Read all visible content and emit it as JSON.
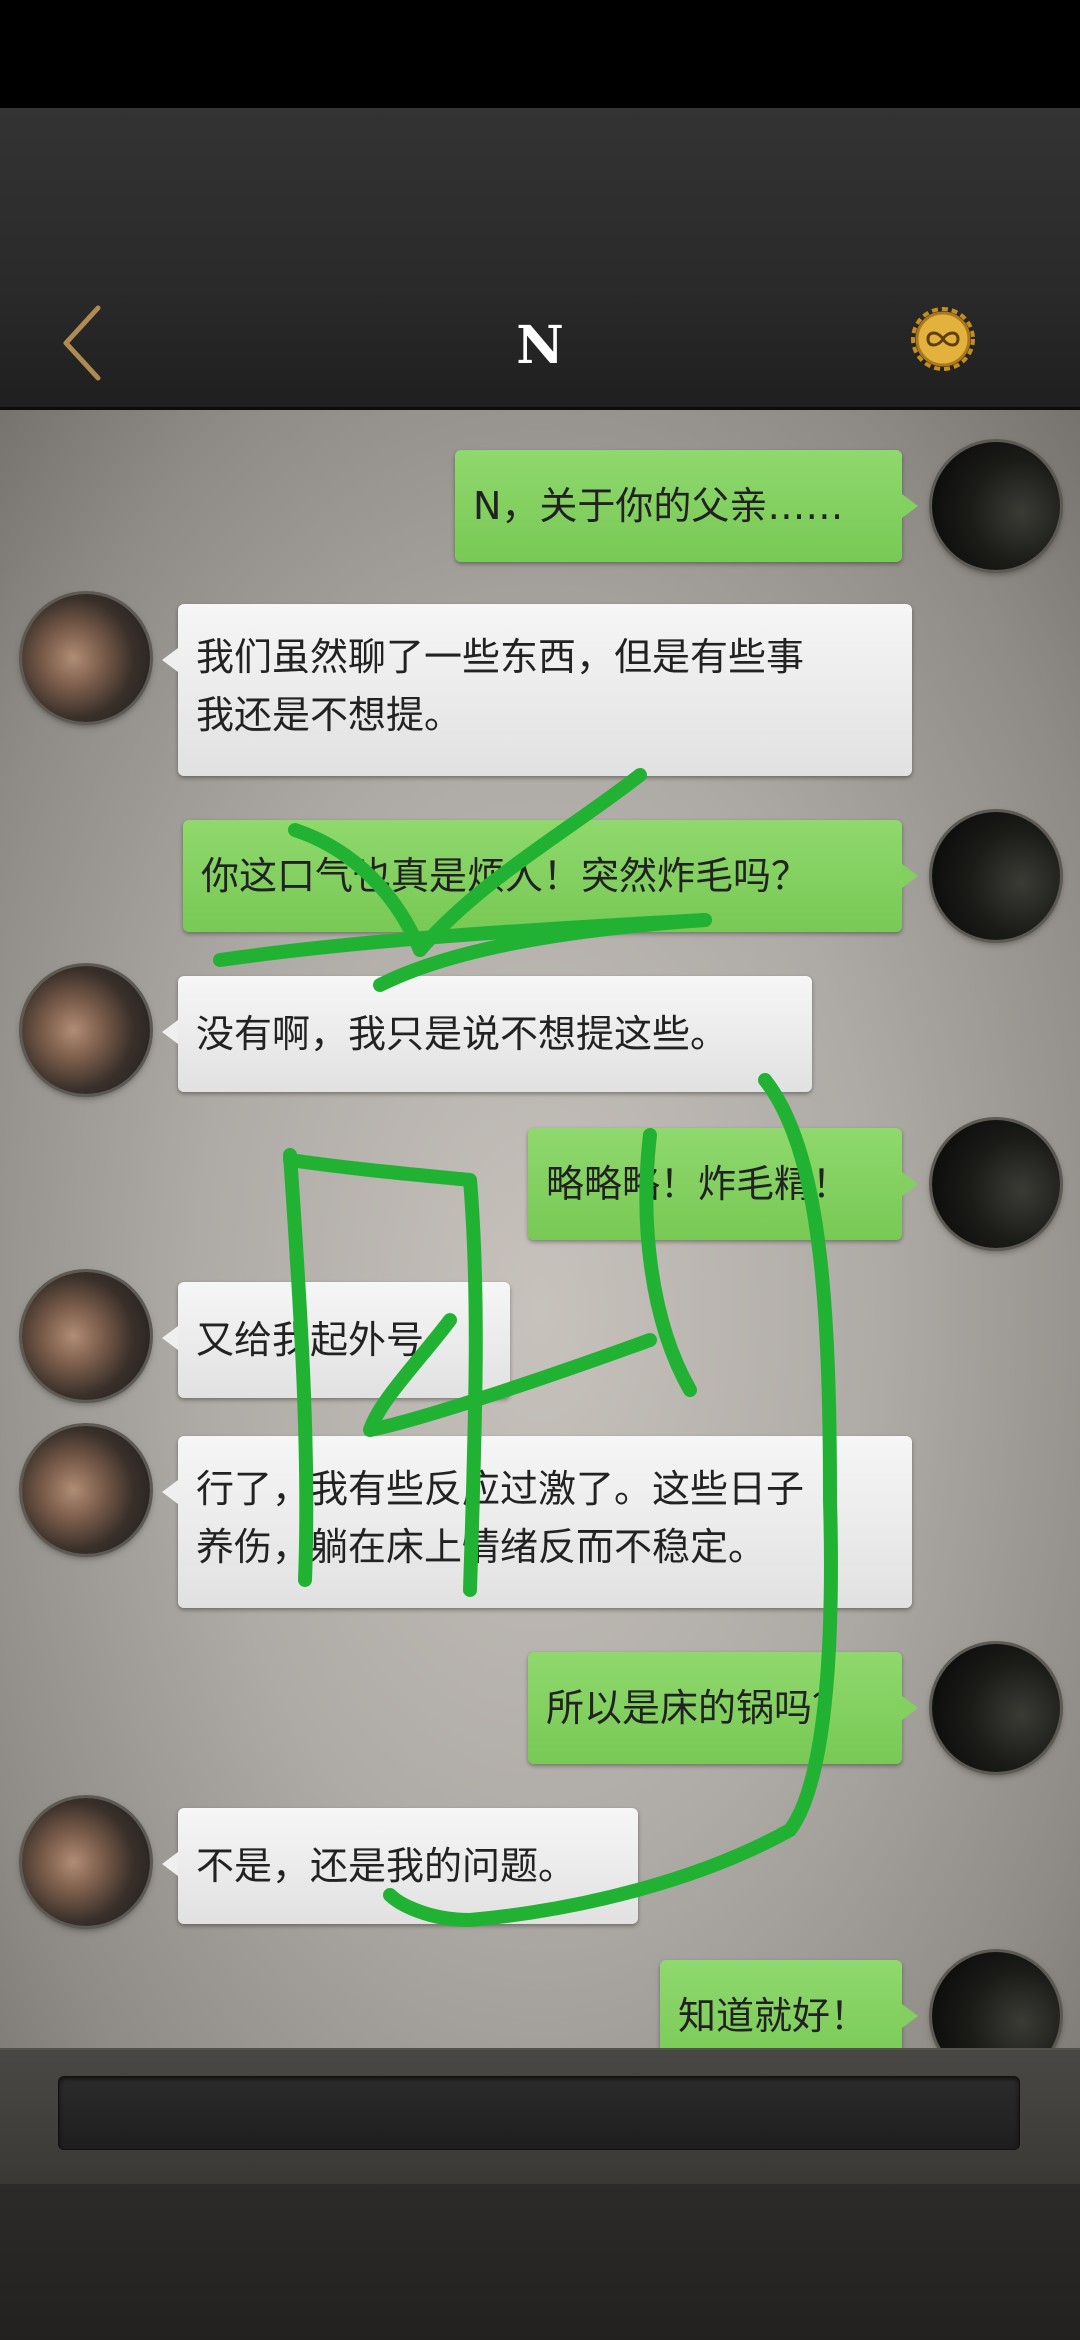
{
  "header": {
    "title": "N",
    "back_icon": "chevron-left-icon",
    "coin_icon": "infinity-coin-icon"
  },
  "colors": {
    "my_bubble": "#82d05f",
    "their_bubble": "#efefef",
    "doodle_stroke": "#22b233",
    "back_icon": "#b08a52",
    "coin": "#e3b23c"
  },
  "messages": [
    {
      "from": "me",
      "text": "N，关于你的父亲……"
    },
    {
      "from": "n",
      "lines": [
        "我们虽然聊了一些东西，但是有些事",
        "我还是不想提。"
      ]
    },
    {
      "from": "me",
      "text": "你这口气也真是烦人！突然炸毛吗？"
    },
    {
      "from": "n",
      "text": "没有啊，我只是说不想提这些。"
    },
    {
      "from": "me",
      "text": "略略略！炸毛精！"
    },
    {
      "from": "n",
      "text": "又给我起外号"
    },
    {
      "from": "n",
      "lines": [
        "行了，我有些反应过激了。这些日子",
        "养伤，躺在床上情绪反而不稳定。"
      ]
    },
    {
      "from": "me",
      "text": "所以是床的锅吗？"
    },
    {
      "from": "n",
      "text": "不是，还是我的问题。"
    },
    {
      "from": "me",
      "text": "知道就好！"
    }
  ],
  "input": {
    "value": "",
    "placeholder": ""
  }
}
